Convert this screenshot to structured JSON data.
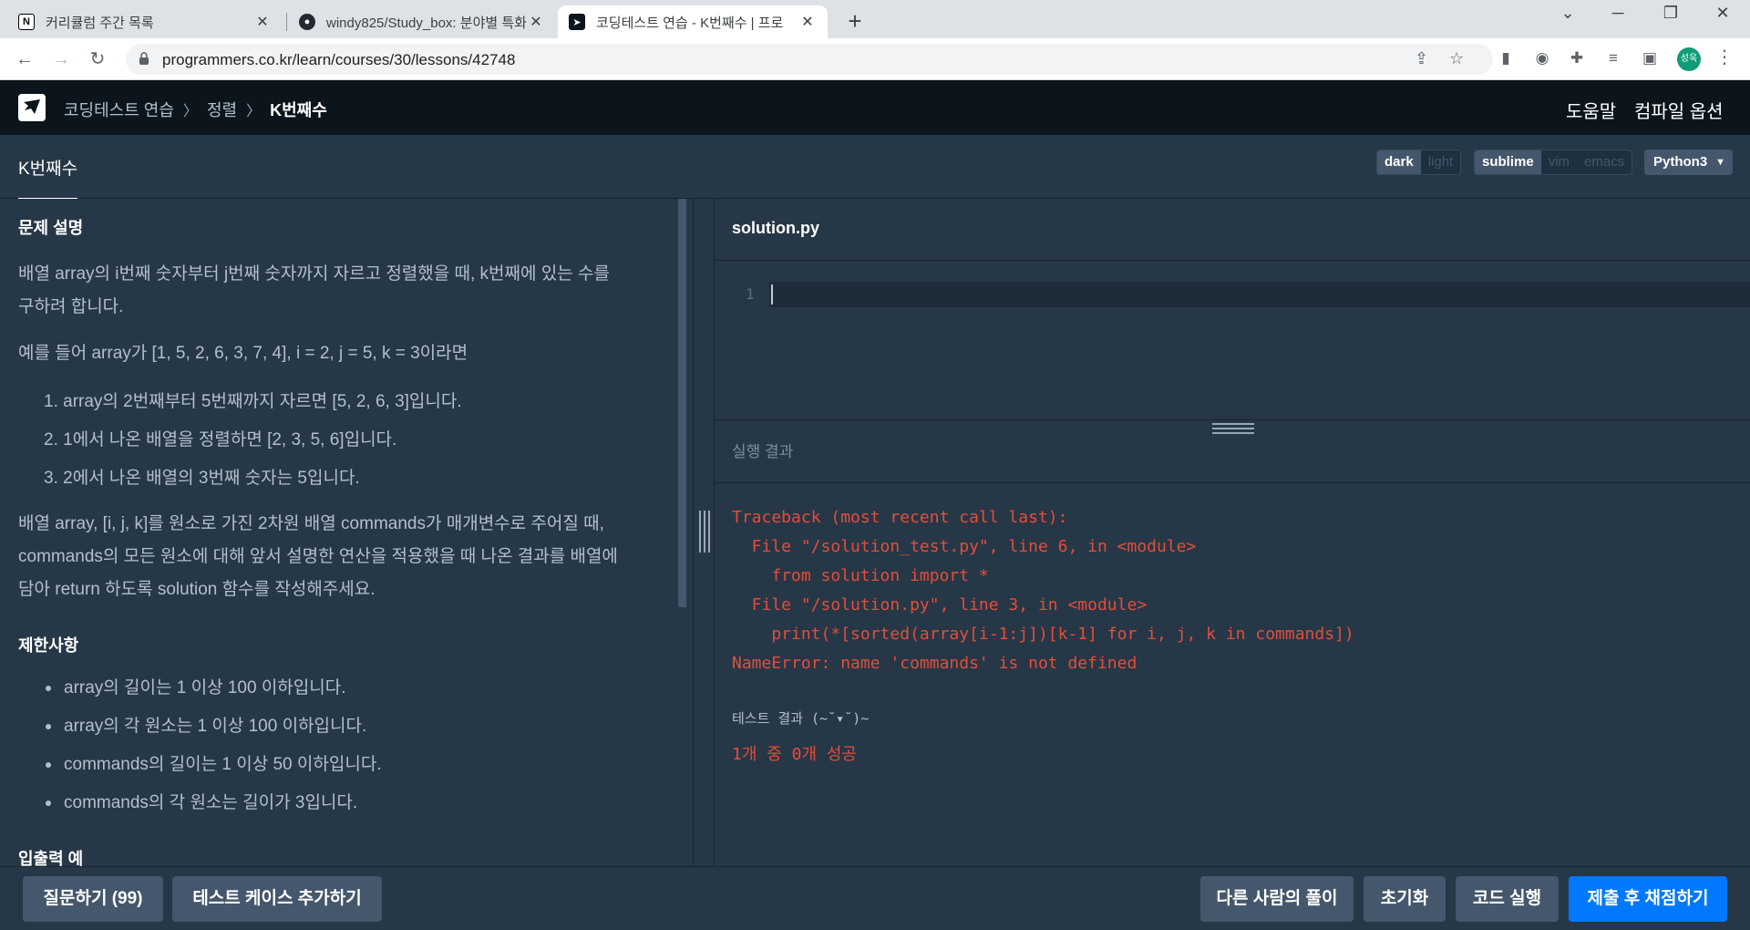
{
  "browser": {
    "tabs": [
      {
        "title": "커리큘럼 주간 목록",
        "icon": "notion-icon"
      },
      {
        "title": "windy825/Study_box: 분야별 특화",
        "icon": "github-icon"
      },
      {
        "title": "코딩테스트 연습 - K번째수 | 프로",
        "icon": "programmers-icon"
      }
    ],
    "url": "programmers.co.kr/learn/courses/30/lessons/42748",
    "profile_initial": "성욱"
  },
  "header": {
    "breadcrumb": [
      "코딩테스트 연습",
      "정렬",
      "K번째수"
    ],
    "help": "도움말",
    "compile_options": "컴파일 옵션"
  },
  "titlebar": {
    "lesson_tab": "K번째수",
    "theme_options": [
      "dark",
      "light"
    ],
    "keymap_options": [
      "sublime",
      "vim",
      "emacs"
    ],
    "language": "Python3"
  },
  "problem": {
    "heading": "문제 설명",
    "desc_line1": "배열 array의 i번째 숫자부터 j번째 숫자까지 자르고 정렬했을 때, k번째에 있는 수를",
    "desc_line2": "구하려 합니다.",
    "example_intro": "예를 들어 array가 [1, 5, 2, 6, 3, 7, 4], i = 2, j = 5, k = 3이라면",
    "steps": [
      "1. array의 2번째부터 5번째까지 자르면 [5, 2, 6, 3]입니다.",
      "2. 1에서 나온 배열을 정렬하면 [2, 3, 5, 6]입니다.",
      "3. 2에서 나온 배열의 3번째 숫자는 5입니다."
    ],
    "task_line1": "배열 array, [i, j, k]를 원소로 가진 2차원 배열 commands가 매개변수로 주어질 때,",
    "task_line2": "commands의 모든 원소에 대해 앞서 설명한 연산을 적용했을 때 나온 결과를 배열에",
    "task_line3": "담아 return 하도록 solution 함수를 작성해주세요.",
    "constraints_heading": "제한사항",
    "constraints": [
      "array의 길이는 1 이상 100 이하입니다.",
      "array의 각 원소는 1 이상 100 이하입니다.",
      "commands의 길이는 1 이상 50 이하입니다.",
      "commands의 각 원소는 길이가 3입니다."
    ],
    "io_heading": "입출력 예"
  },
  "editor": {
    "filename": "solution.py",
    "line_number": "1"
  },
  "result": {
    "title": "실행 결과",
    "traceback": [
      "Traceback (most recent call last):",
      "  File \"/solution_test.py\", line 6, in <module>",
      "    from solution import *",
      "  File \"/solution.py\", line 3, in <module>",
      "    print(*[sorted(array[i-1:j])[k-1] for i, j, k in commands])",
      "NameError: name 'commands' is not defined"
    ],
    "test_label": "테스트 결과 (~˘▾˘)~",
    "test_summary": "1개 중 0개 성공"
  },
  "footer": {
    "ask": "질문하기 (99)",
    "add_testcase": "테스트 케이스 추가하기",
    "others_solutions": "다른 사람의 풀이",
    "reset": "초기화",
    "run": "코드 실행",
    "submit": "제출 후 채점하기"
  },
  "colors": {
    "bg": "#263747",
    "header_bg": "#0c151c",
    "error": "#e34e3a",
    "primary": "#0078ff"
  }
}
